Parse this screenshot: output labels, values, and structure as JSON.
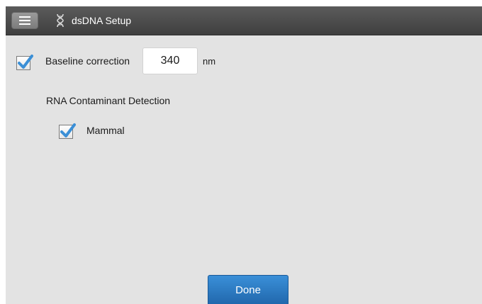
{
  "header": {
    "menu_icon": "hamburger-menu-icon",
    "app_icon": "dna-helix-icon",
    "title": "dsDNA Setup"
  },
  "settings": {
    "baseline_correction": {
      "checked": true,
      "label": "Baseline correction",
      "value": "340",
      "unit": "nm"
    },
    "rna_contaminant": {
      "heading": "RNA Contaminant Detection",
      "mammal": {
        "checked": true,
        "label": "Mammal"
      }
    }
  },
  "footer": {
    "done_label": "Done"
  },
  "colors": {
    "titlebar": "#4a4a4a",
    "panel": "#e3e3e3",
    "check": "#3b8fd6",
    "done_button": "#2a78c2"
  }
}
